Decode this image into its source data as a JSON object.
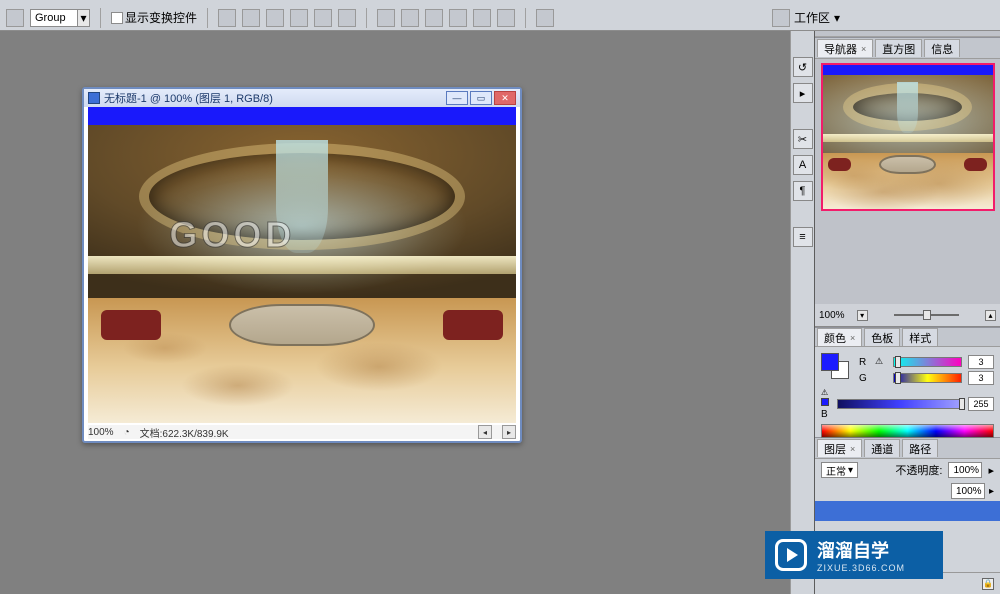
{
  "optionsbar": {
    "group_label": "Group",
    "show_transform_controls": "显示变换控件",
    "workspace_label": "工作区"
  },
  "document": {
    "title": "无标题-1 @ 100% (图层 1, RGB/8)",
    "zoom": "100%",
    "file_info": "文档:622.3K/839.9K",
    "marquee_caption": "GOOD"
  },
  "panels": {
    "navigator": {
      "tab1": "导航器",
      "tab2": "直方图",
      "tab3": "信息",
      "zoom": "100%"
    },
    "color": {
      "tab1": "颜色",
      "tab2": "色板",
      "tab3": "样式",
      "r_label": "R",
      "g_label": "G",
      "b_label": "B",
      "r_val": "3",
      "g_val": "3",
      "b_val": "255"
    },
    "layers": {
      "tab1": "图层",
      "tab2": "通道",
      "tab3": "路径",
      "blend_mode": "正常",
      "opacity_label": "不透明度:",
      "opacity_val": "100%",
      "fill_val": "100%"
    }
  },
  "watermark": {
    "brand": "溜溜自学",
    "sub": "ZIXUE.3D66.COM"
  },
  "colors": {
    "accent_blue": "#1b1bff",
    "panel_bg": "#d0d4da"
  }
}
